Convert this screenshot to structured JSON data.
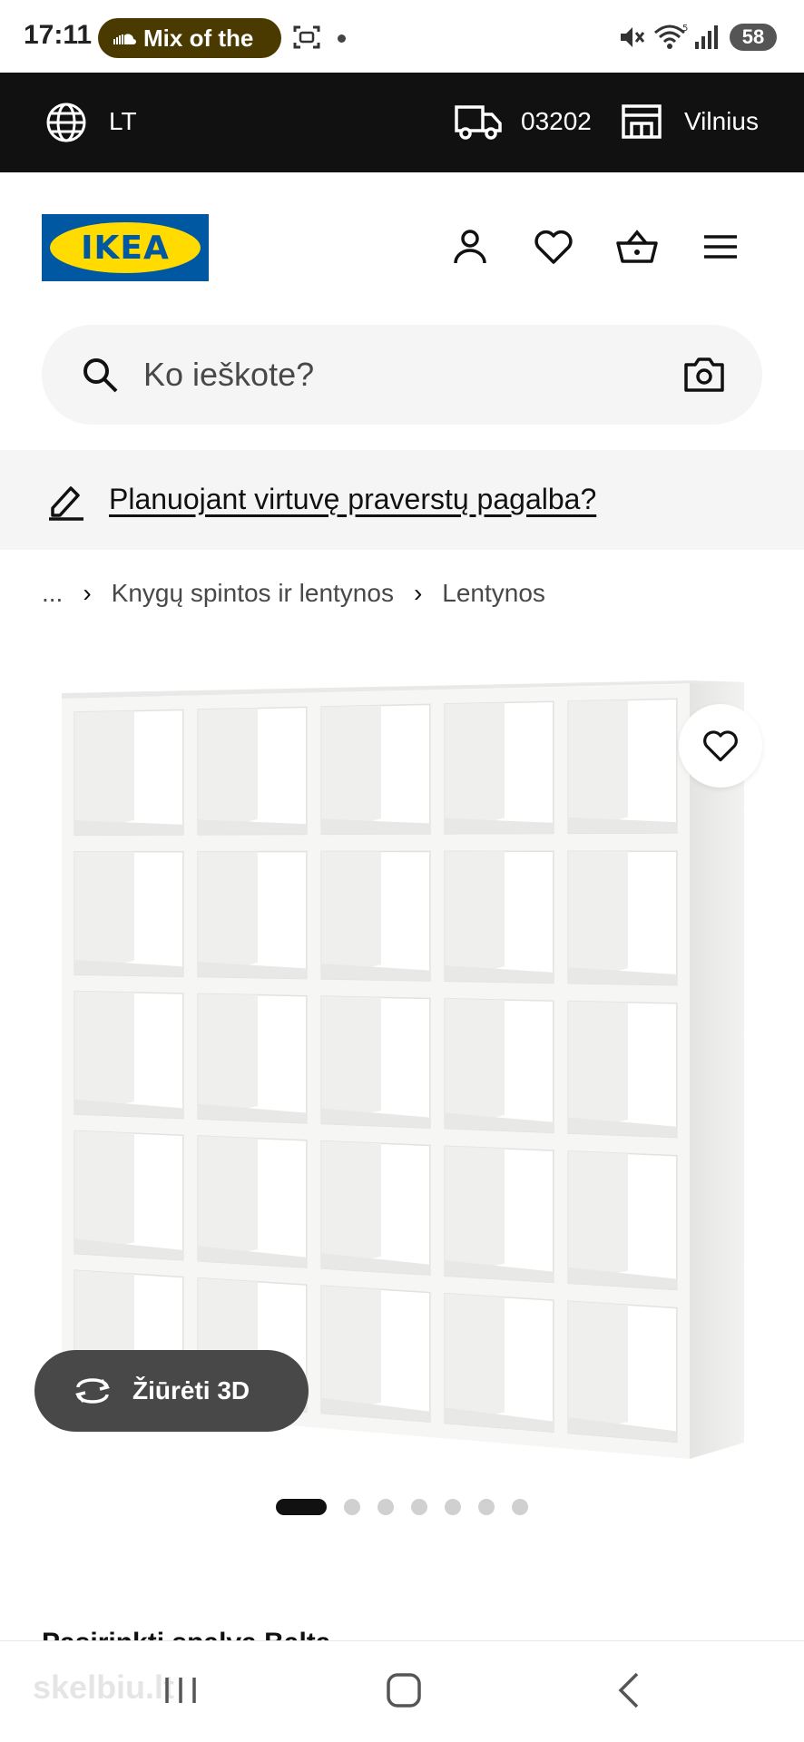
{
  "status_bar": {
    "time": "17:11",
    "media_pill": "Mix of the",
    "battery": "58"
  },
  "top_bar": {
    "language": "LT",
    "postal_code": "03202",
    "store": "Vilnius"
  },
  "header": {
    "logo_text": "IKEA"
  },
  "search": {
    "placeholder": "Ko ieškote?"
  },
  "banner": {
    "link_text": "Planuojant virtuvę praverstų pagalba?"
  },
  "breadcrumb": {
    "items": [
      "...",
      "Knygų spintos ir lentynos",
      "Lentynos"
    ]
  },
  "gallery": {
    "view_3d_label": "Žiūrėti 3D",
    "dot_count": 7,
    "active_index": 0
  },
  "partial_text": "Pasirinkti spalvą Balta",
  "nav": {
    "watermark": "skelbiu.lt"
  },
  "colors": {
    "brand_blue": "#0058a3",
    "brand_yellow": "#ffdb00",
    "top_bar": "#111111",
    "pill": "#4a3a00"
  },
  "icons": [
    "globe-icon",
    "truck-icon",
    "store-icon",
    "user-icon",
    "heart-icon",
    "basket-icon",
    "menu-icon",
    "search-icon",
    "camera-icon",
    "pencil-icon",
    "rotate-3d-icon"
  ]
}
